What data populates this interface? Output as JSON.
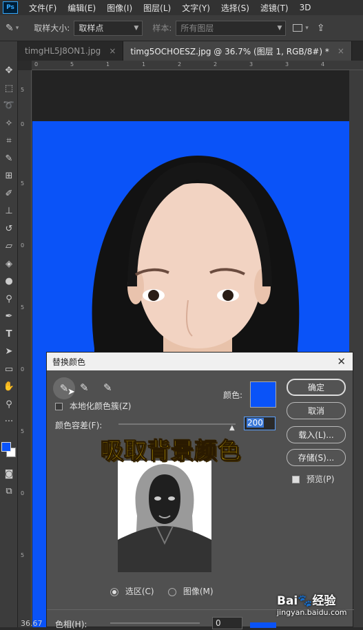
{
  "menubar": {
    "logo": "Ps",
    "items": [
      "文件(F)",
      "编辑(E)",
      "图像(I)",
      "图层(L)",
      "文字(Y)",
      "选择(S)",
      "滤镜(T)",
      "3D"
    ]
  },
  "options": {
    "sample_size_label": "取样大小:",
    "sample_size_value": "取样点",
    "sample_label": "样本:",
    "sample_value": "所有图层"
  },
  "tabs": [
    {
      "label": "timgHL5J8ON1.jpg",
      "active": false
    },
    {
      "label": "timg5OCHOESZ.jpg @ 36.7% (图层 1, RGB/8#) *",
      "active": true
    }
  ],
  "ruler": {
    "top": [
      "0",
      "5",
      "1",
      "1",
      "2",
      "2",
      "3",
      "3",
      "4"
    ],
    "left": [
      "5",
      "0",
      "5",
      "0",
      "5",
      "0",
      "5",
      "0",
      "5"
    ]
  },
  "status": {
    "zoom": "36.67"
  },
  "colors": {
    "foreground": "#0a53f8",
    "background": "#ffffff",
    "photo_bg": "#0a53f8",
    "caption": "#ffd700"
  },
  "dialog": {
    "title": "替换颜色",
    "localized_clusters": "本地化颜色簇(Z)",
    "color_label": "颜色:",
    "swatch_color": "#0a53f8",
    "tolerance_label": "颜色容差(F):",
    "tolerance_value": "200",
    "tolerance_fraction": 1.0,
    "selection_radio": "选区(C)",
    "image_radio": "图像(M)",
    "hue_label": "色相(H):",
    "hue_value": "0",
    "buttons": {
      "ok": "确定",
      "cancel": "取消",
      "load": "载入(L)...",
      "save": "存储(S)..."
    },
    "preview_label": "预览(P)",
    "preview_checked": true
  },
  "caption": "吸取背景颜色",
  "watermark": {
    "brand": "Bai",
    "brand2": "经验",
    "url": "jingyan.baidu.com"
  }
}
